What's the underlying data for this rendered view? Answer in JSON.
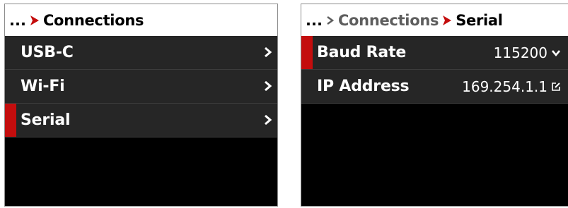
{
  "colors": {
    "accent": "#c40d0d",
    "row_bg": "#262626",
    "panel_bg": "#000000"
  },
  "left_panel": {
    "breadcrumb": {
      "ellipsis": "...",
      "current": "Connections"
    },
    "items": [
      {
        "label": "USB-C",
        "icon": "chevron-right-icon",
        "selected": false
      },
      {
        "label": "Wi-Fi",
        "icon": "chevron-right-icon",
        "selected": false
      },
      {
        "label": "Serial",
        "icon": "chevron-right-icon",
        "selected": true
      }
    ]
  },
  "right_panel": {
    "breadcrumb": {
      "ellipsis": "...",
      "parent": "Connections",
      "current": "Serial"
    },
    "items": [
      {
        "label": "Baud Rate",
        "value": "115200",
        "icon": "chevron-down-icon",
        "selected": true
      },
      {
        "label": "IP Address",
        "value": "169.254.1.1",
        "icon": "edit-icon",
        "selected": false
      }
    ]
  }
}
